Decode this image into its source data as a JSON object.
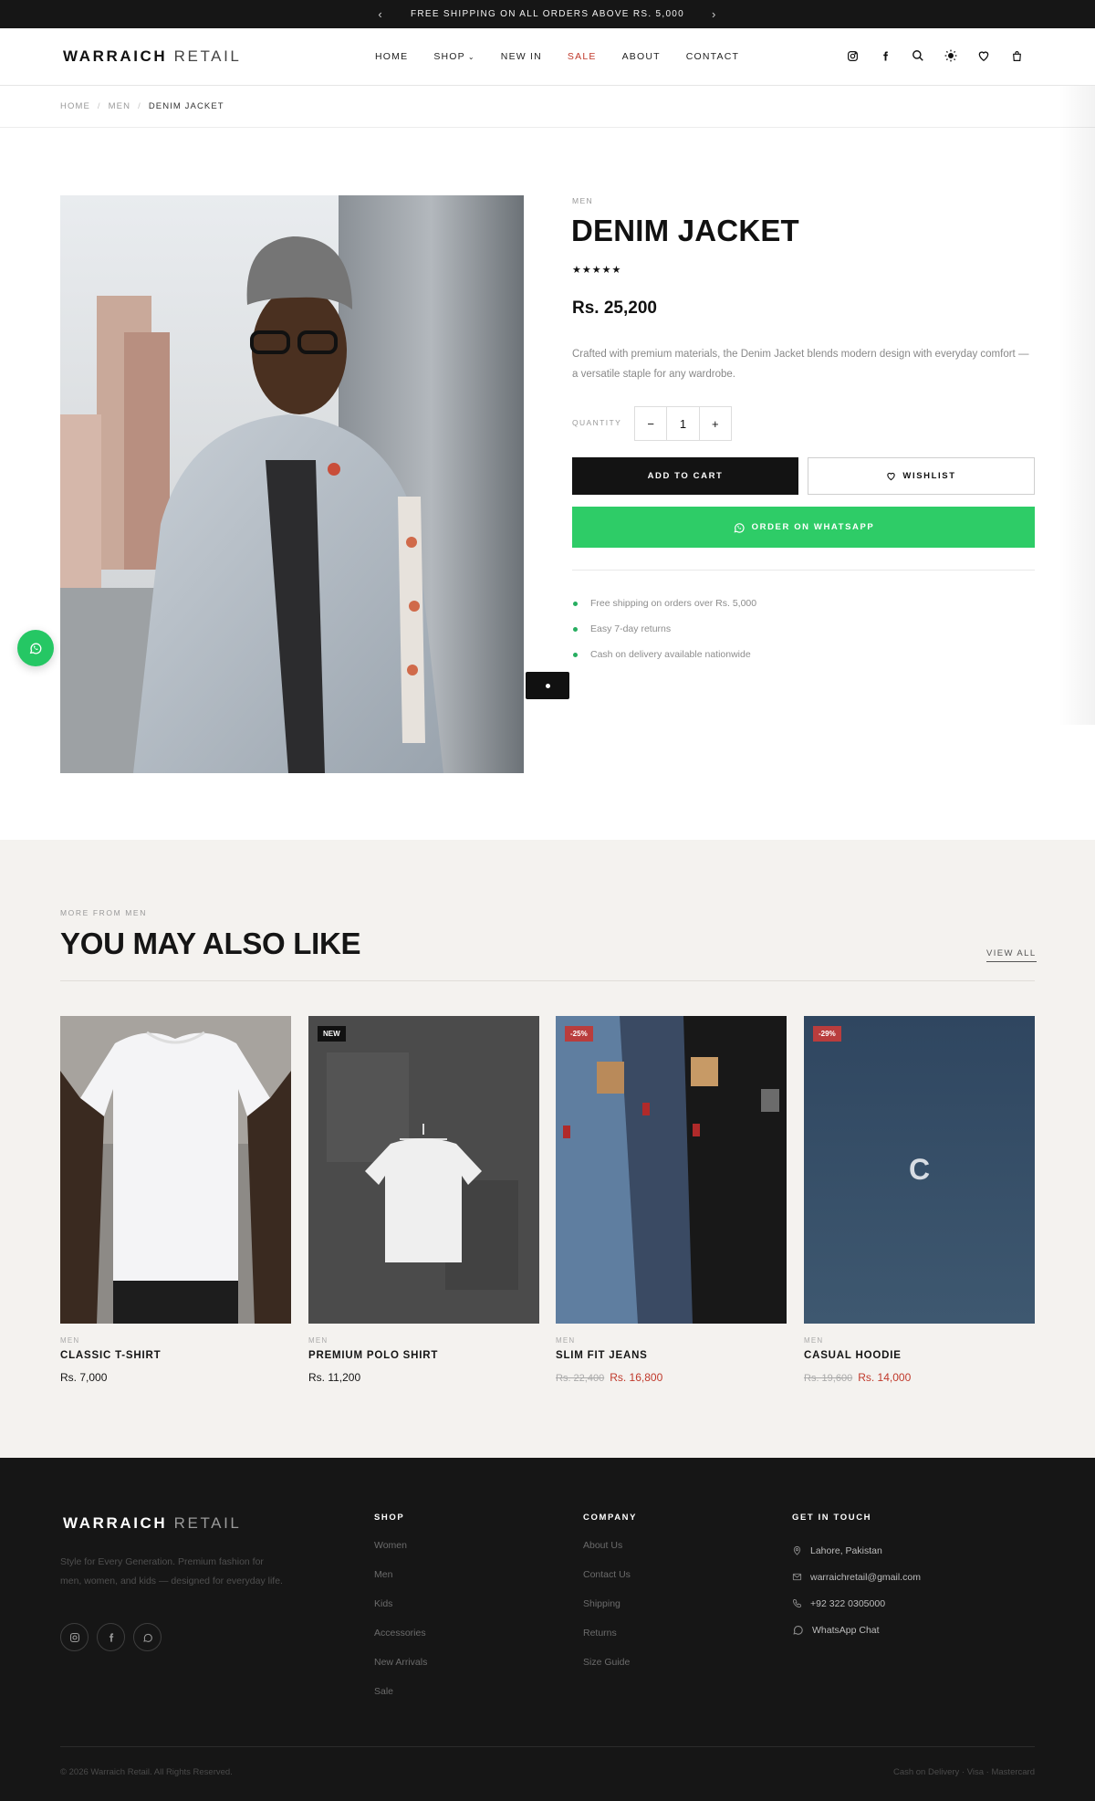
{
  "announcement": {
    "text": "FREE SHIPPING ON ALL ORDERS ABOVE RS. 5,000",
    "prev_icon": "chevron-left-icon",
    "next_icon": "chevron-right-icon"
  },
  "header": {
    "logo_bold": "WARRAICH",
    "logo_light": "RETAIL",
    "nav": [
      {
        "label": "HOME"
      },
      {
        "label": "SHOP",
        "has_dropdown": true
      },
      {
        "label": "NEW IN"
      },
      {
        "label": "SALE",
        "highlight_color": "#c0392b"
      },
      {
        "label": "ABOUT"
      },
      {
        "label": "CONTACT"
      }
    ],
    "icons": [
      "instagram-icon",
      "facebook-icon",
      "search-icon",
      "theme-toggle-icon",
      "wishlist-heart-icon",
      "cart-bag-icon"
    ]
  },
  "breadcrumb": {
    "items": [
      "HOME",
      "MEN"
    ],
    "current": "DENIM JACKET",
    "separator": "/"
  },
  "product": {
    "category": "MEN",
    "title": "DENIM JACKET",
    "stars": "★★★★★",
    "rating": 5,
    "price": "Rs. 25,200",
    "description": "Crafted with premium materials, the Denim Jacket blends modern design with everyday comfort — a versatile staple for any wardrobe.",
    "quantity_label": "QUANTITY",
    "quantity": "1",
    "minus": "−",
    "plus": "+",
    "add_to_cart": "ADD TO CART",
    "wishlist": "WISHLIST",
    "order_whatsapp": "ORDER ON WHATSAPP",
    "perks": [
      "Free shipping on orders over Rs. 5,000",
      "Easy 7-day returns",
      "Cash on delivery available nationwide"
    ],
    "colors": {
      "whatsapp": "#2ecc67",
      "perk_dot": "#27ae60",
      "cart": "#131313"
    }
  },
  "related": {
    "kicker": "MORE FROM MEN",
    "title": "YOU MAY ALSO LIKE",
    "view_all": "VIEW ALL",
    "products": [
      {
        "category": "MEN",
        "name": "CLASSIC T-SHIRT",
        "price": "Rs. 7,000",
        "old_price": "",
        "badge": ""
      },
      {
        "category": "MEN",
        "name": "PREMIUM POLO SHIRT",
        "price": "Rs. 11,200",
        "old_price": "",
        "badge": "NEW"
      },
      {
        "category": "MEN",
        "name": "SLIM FIT JEANS",
        "price": "Rs. 16,800",
        "old_price": "Rs. 22,400",
        "badge": "-25%"
      },
      {
        "category": "MEN",
        "name": "CASUAL HOODIE",
        "price": "Rs. 14,000",
        "old_price": "Rs. 19,600",
        "badge": "-29%",
        "placeholder_letter": "C"
      }
    ]
  },
  "footer": {
    "logo_bold": "WARRAICH",
    "logo_light": "RETAIL",
    "tagline": "Style for Every Generation. Premium fashion for men, women, and kids — designed for everyday life.",
    "social_icons": [
      "instagram-icon",
      "facebook-icon",
      "whatsapp-icon"
    ],
    "shop": {
      "heading": "SHOP",
      "links": [
        "Women",
        "Men",
        "Kids",
        "Accessories",
        "New Arrivals",
        "Sale"
      ]
    },
    "company": {
      "heading": "COMPANY",
      "links": [
        "About Us",
        "Contact Us",
        "Shipping",
        "Returns",
        "Size Guide"
      ]
    },
    "contact": {
      "heading": "GET IN TOUCH",
      "location": "Lahore, Pakistan",
      "email": "warraichretail@gmail.com",
      "phone": "+92 322 0305000",
      "whatsapp": "WhatsApp Chat"
    },
    "copyright": "© 2026 Warraich Retail. All Rights Reserved.",
    "payments": "Cash on Delivery · Visa · Mastercard"
  }
}
